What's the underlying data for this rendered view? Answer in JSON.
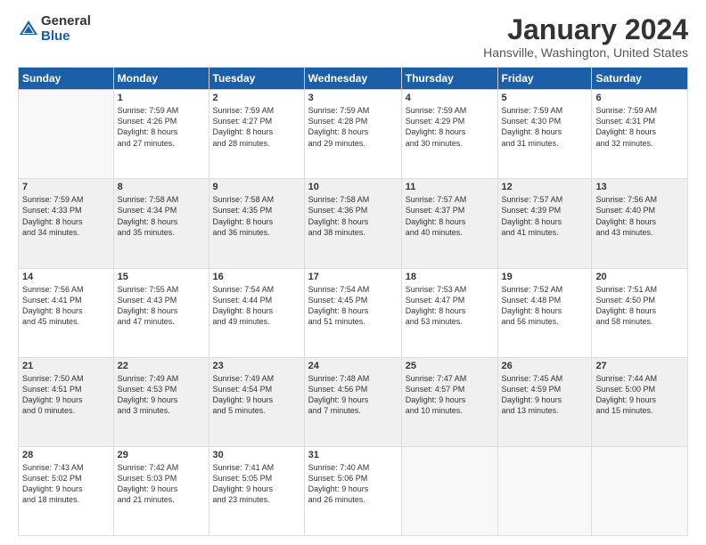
{
  "logo": {
    "general": "General",
    "blue": "Blue"
  },
  "title": "January 2024",
  "subtitle": "Hansville, Washington, United States",
  "weekdays": [
    "Sunday",
    "Monday",
    "Tuesday",
    "Wednesday",
    "Thursday",
    "Friday",
    "Saturday"
  ],
  "rows": [
    [
      {
        "day": "",
        "content": ""
      },
      {
        "day": "1",
        "content": "Sunrise: 7:59 AM\nSunset: 4:26 PM\nDaylight: 8 hours\nand 27 minutes."
      },
      {
        "day": "2",
        "content": "Sunrise: 7:59 AM\nSunset: 4:27 PM\nDaylight: 8 hours\nand 28 minutes."
      },
      {
        "day": "3",
        "content": "Sunrise: 7:59 AM\nSunset: 4:28 PM\nDaylight: 8 hours\nand 29 minutes."
      },
      {
        "day": "4",
        "content": "Sunrise: 7:59 AM\nSunset: 4:29 PM\nDaylight: 8 hours\nand 30 minutes."
      },
      {
        "day": "5",
        "content": "Sunrise: 7:59 AM\nSunset: 4:30 PM\nDaylight: 8 hours\nand 31 minutes."
      },
      {
        "day": "6",
        "content": "Sunrise: 7:59 AM\nSunset: 4:31 PM\nDaylight: 8 hours\nand 32 minutes."
      }
    ],
    [
      {
        "day": "7",
        "content": "Sunrise: 7:59 AM\nSunset: 4:33 PM\nDaylight: 8 hours\nand 34 minutes."
      },
      {
        "day": "8",
        "content": "Sunrise: 7:58 AM\nSunset: 4:34 PM\nDaylight: 8 hours\nand 35 minutes."
      },
      {
        "day": "9",
        "content": "Sunrise: 7:58 AM\nSunset: 4:35 PM\nDaylight: 8 hours\nand 36 minutes."
      },
      {
        "day": "10",
        "content": "Sunrise: 7:58 AM\nSunset: 4:36 PM\nDaylight: 8 hours\nand 38 minutes."
      },
      {
        "day": "11",
        "content": "Sunrise: 7:57 AM\nSunset: 4:37 PM\nDaylight: 8 hours\nand 40 minutes."
      },
      {
        "day": "12",
        "content": "Sunrise: 7:57 AM\nSunset: 4:39 PM\nDaylight: 8 hours\nand 41 minutes."
      },
      {
        "day": "13",
        "content": "Sunrise: 7:56 AM\nSunset: 4:40 PM\nDaylight: 8 hours\nand 43 minutes."
      }
    ],
    [
      {
        "day": "14",
        "content": "Sunrise: 7:56 AM\nSunset: 4:41 PM\nDaylight: 8 hours\nand 45 minutes."
      },
      {
        "day": "15",
        "content": "Sunrise: 7:55 AM\nSunset: 4:43 PM\nDaylight: 8 hours\nand 47 minutes."
      },
      {
        "day": "16",
        "content": "Sunrise: 7:54 AM\nSunset: 4:44 PM\nDaylight: 8 hours\nand 49 minutes."
      },
      {
        "day": "17",
        "content": "Sunrise: 7:54 AM\nSunset: 4:45 PM\nDaylight: 8 hours\nand 51 minutes."
      },
      {
        "day": "18",
        "content": "Sunrise: 7:53 AM\nSunset: 4:47 PM\nDaylight: 8 hours\nand 53 minutes."
      },
      {
        "day": "19",
        "content": "Sunrise: 7:52 AM\nSunset: 4:48 PM\nDaylight: 8 hours\nand 56 minutes."
      },
      {
        "day": "20",
        "content": "Sunrise: 7:51 AM\nSunset: 4:50 PM\nDaylight: 8 hours\nand 58 minutes."
      }
    ],
    [
      {
        "day": "21",
        "content": "Sunrise: 7:50 AM\nSunset: 4:51 PM\nDaylight: 9 hours\nand 0 minutes."
      },
      {
        "day": "22",
        "content": "Sunrise: 7:49 AM\nSunset: 4:53 PM\nDaylight: 9 hours\nand 3 minutes."
      },
      {
        "day": "23",
        "content": "Sunrise: 7:49 AM\nSunset: 4:54 PM\nDaylight: 9 hours\nand 5 minutes."
      },
      {
        "day": "24",
        "content": "Sunrise: 7:48 AM\nSunset: 4:56 PM\nDaylight: 9 hours\nand 7 minutes."
      },
      {
        "day": "25",
        "content": "Sunrise: 7:47 AM\nSunset: 4:57 PM\nDaylight: 9 hours\nand 10 minutes."
      },
      {
        "day": "26",
        "content": "Sunrise: 7:45 AM\nSunset: 4:59 PM\nDaylight: 9 hours\nand 13 minutes."
      },
      {
        "day": "27",
        "content": "Sunrise: 7:44 AM\nSunset: 5:00 PM\nDaylight: 9 hours\nand 15 minutes."
      }
    ],
    [
      {
        "day": "28",
        "content": "Sunrise: 7:43 AM\nSunset: 5:02 PM\nDaylight: 9 hours\nand 18 minutes."
      },
      {
        "day": "29",
        "content": "Sunrise: 7:42 AM\nSunset: 5:03 PM\nDaylight: 9 hours\nand 21 minutes."
      },
      {
        "day": "30",
        "content": "Sunrise: 7:41 AM\nSunset: 5:05 PM\nDaylight: 9 hours\nand 23 minutes."
      },
      {
        "day": "31",
        "content": "Sunrise: 7:40 AM\nSunset: 5:06 PM\nDaylight: 9 hours\nand 26 minutes."
      },
      {
        "day": "",
        "content": ""
      },
      {
        "day": "",
        "content": ""
      },
      {
        "day": "",
        "content": ""
      }
    ]
  ]
}
